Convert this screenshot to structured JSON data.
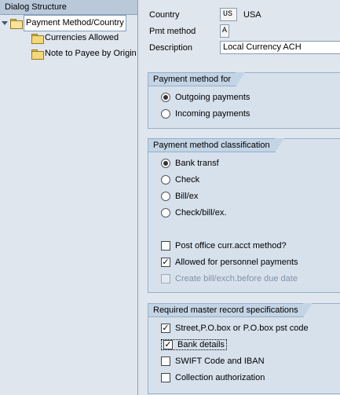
{
  "dialog_structure": {
    "header": "Dialog Structure",
    "items": [
      {
        "label": "Payment Method/Country",
        "icon": "folder-open-icon",
        "expanded": true,
        "selected": true
      },
      {
        "label": "Currencies Allowed",
        "icon": "folder-icon"
      },
      {
        "label": "Note to Payee by Origin",
        "icon": "folder-icon"
      }
    ]
  },
  "header_fields": {
    "country": {
      "label": "Country",
      "code": "US",
      "name": "USA"
    },
    "pmt_method": {
      "label": "Pmt method",
      "value": "A"
    },
    "description": {
      "label": "Description",
      "value": "Local Currency ACH"
    }
  },
  "payment_method_for": {
    "title": "Payment method for",
    "options": [
      {
        "label": "Outgoing payments",
        "selected": true
      },
      {
        "label": "Incoming payments",
        "selected": false
      }
    ]
  },
  "classification": {
    "title": "Payment method classification",
    "radios": [
      {
        "label": "Bank transf",
        "selected": true
      },
      {
        "label": "Check",
        "selected": false
      },
      {
        "label": "Bill/ex",
        "selected": false
      },
      {
        "label": "Check/bill/ex.",
        "selected": false
      }
    ],
    "checks": [
      {
        "label": "Post office curr.acct method?",
        "checked": false,
        "enabled": true
      },
      {
        "label": "Allowed for personnel payments",
        "checked": true,
        "enabled": true
      },
      {
        "label": "Create bill/exch.before due date",
        "checked": false,
        "enabled": false
      }
    ]
  },
  "master_record": {
    "title": "Required master record specifications",
    "checks": [
      {
        "label": "Street,P.O.box or P.O.box pst code",
        "checked": true
      },
      {
        "label": "Bank details",
        "checked": true,
        "focused": true
      },
      {
        "label": "SWIFT Code and IBAN",
        "checked": false
      },
      {
        "label": "Collection authorization",
        "checked": false
      }
    ]
  }
}
